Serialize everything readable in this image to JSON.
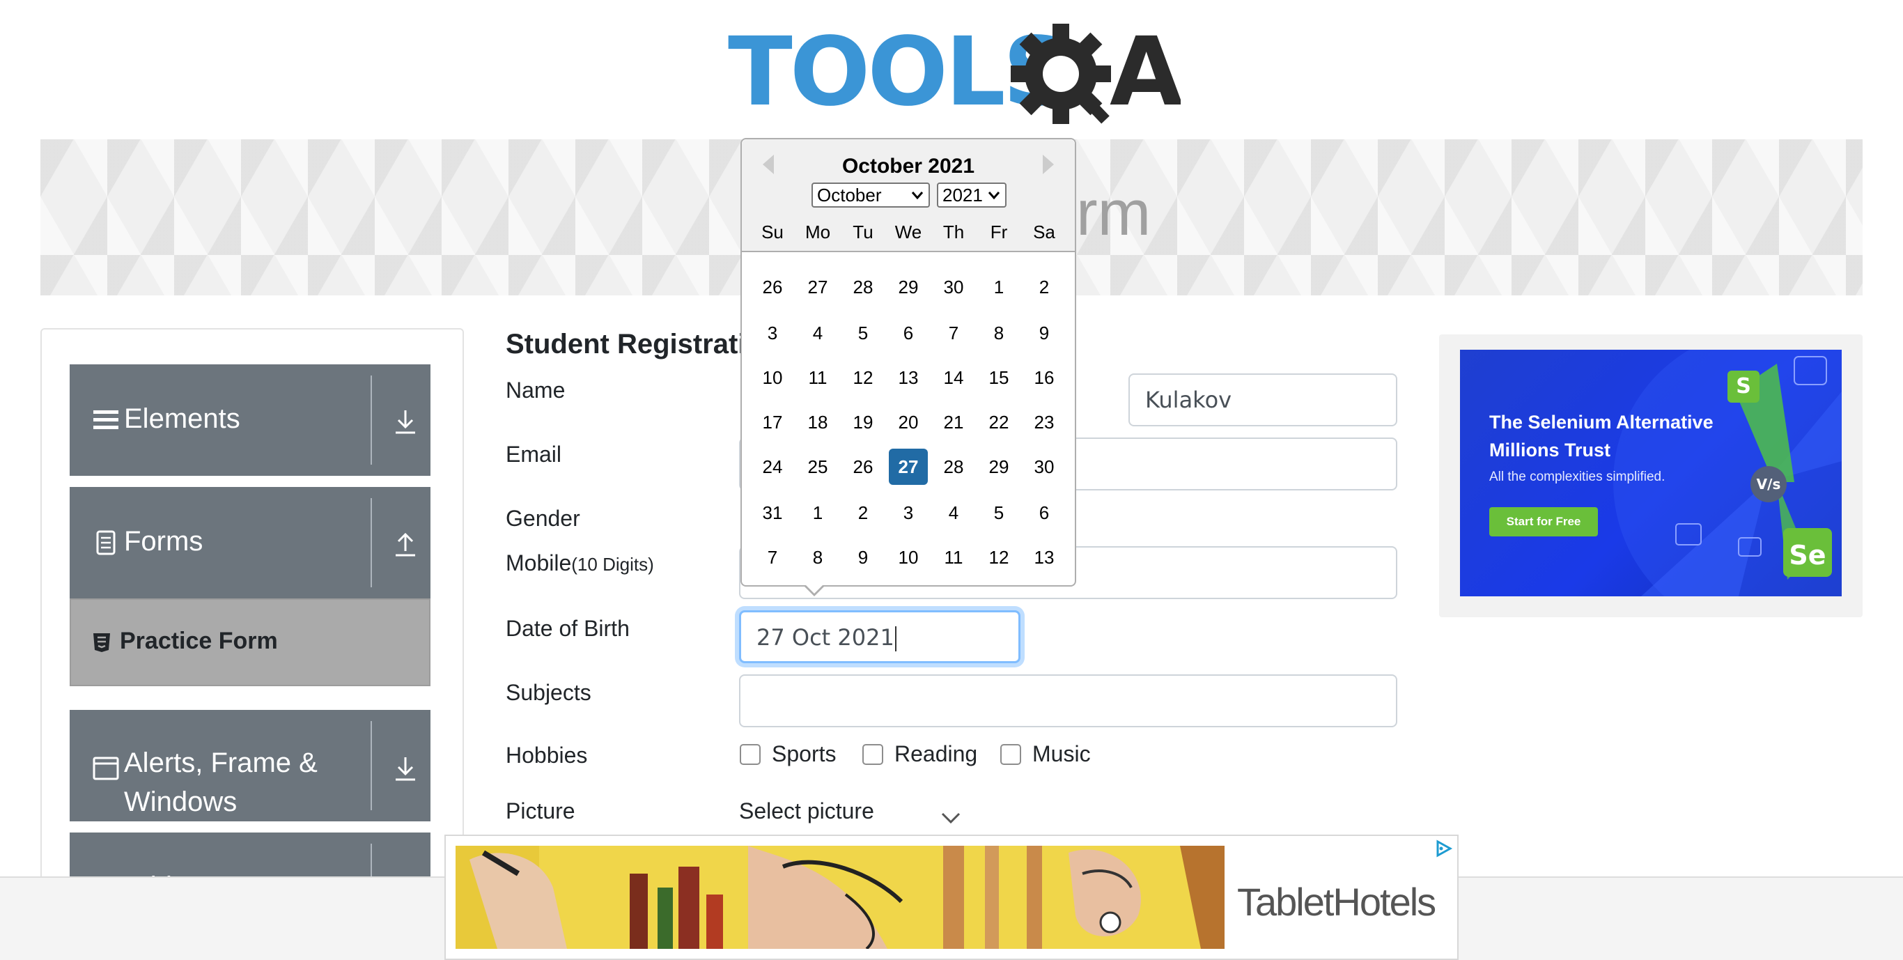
{
  "logo": {
    "brand": "TOOLSQA"
  },
  "banner": {
    "title": "Practice Form"
  },
  "sidebar": {
    "groups": [
      {
        "label": "Elements",
        "icon": "hamburger-icon",
        "arrow": "download-arrow-icon"
      },
      {
        "label": "Forms",
        "icon": "form-document-icon",
        "arrow": "upload-arrow-icon"
      },
      {
        "label": "Alerts, Frame &",
        "label2": "Windows",
        "icon": "browser-window-icon",
        "arrow": "download-arrow-icon"
      },
      {
        "label": "Widgets"
      }
    ],
    "active_item": "Practice Form"
  },
  "form": {
    "heading": "Student Registration Form",
    "labels": {
      "name": "Name",
      "email": "Email",
      "gender": "Gender",
      "mobile": "Mobile",
      "mobile_hint": "(10 Digits)",
      "dob": "Date of Birth",
      "subjects": "Subjects",
      "hobbies": "Hobbies",
      "picture": "Picture"
    },
    "last_name_value": "Kulakov",
    "dob_value": "27 Oct 2021",
    "subjects_value": "",
    "hobbies": [
      "Sports",
      "Reading",
      "Music"
    ],
    "picture_button": "Select picture"
  },
  "datepicker": {
    "title": "October 2021",
    "month_selected": "October",
    "year_selected": "2021",
    "day_names": [
      "Su",
      "Mo",
      "Tu",
      "We",
      "Th",
      "Fr",
      "Sa"
    ],
    "weeks": [
      [
        "26",
        "27",
        "28",
        "29",
        "30",
        "1",
        "2"
      ],
      [
        "3",
        "4",
        "5",
        "6",
        "7",
        "8",
        "9"
      ],
      [
        "10",
        "11",
        "12",
        "13",
        "14",
        "15",
        "16"
      ],
      [
        "17",
        "18",
        "19",
        "20",
        "21",
        "22",
        "23"
      ],
      [
        "24",
        "25",
        "26",
        "27",
        "28",
        "29",
        "30"
      ],
      [
        "31",
        "1",
        "2",
        "3",
        "4",
        "5",
        "6"
      ],
      [
        "7",
        "8",
        "9",
        "10",
        "11",
        "12",
        "13"
      ]
    ],
    "selected_day": "27",
    "selected_color": "#216ba5"
  },
  "ad_right": {
    "headline_line1": "The Selenium Alternative",
    "headline_line2": "Millions Trust",
    "subtext": "All the complexities simplified.",
    "cta": "Start for Free",
    "badge_s": "S",
    "badge_vs": "V/s",
    "badge_se": "Se"
  },
  "ad_bottom": {
    "brand": "TabletHotels"
  },
  "colors": {
    "sidebar_header": "#6c757d",
    "active_item": "#aaaaaa",
    "accent": "#216ba5",
    "focus": "#80bdff"
  }
}
